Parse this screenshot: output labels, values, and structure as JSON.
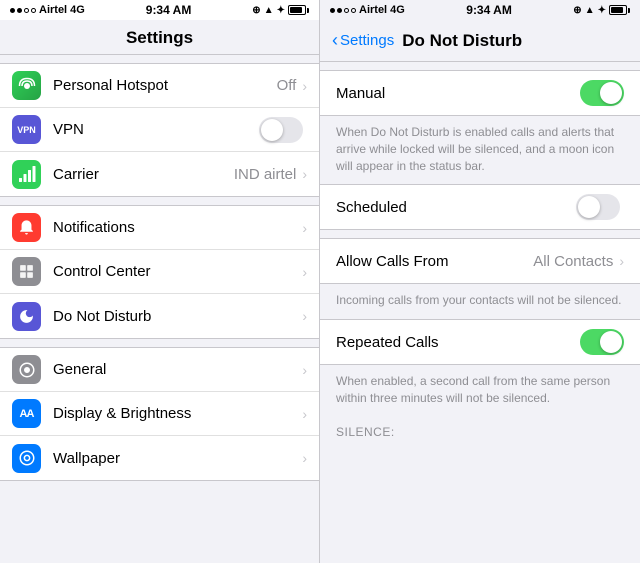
{
  "left": {
    "statusBar": {
      "carrier": "Airtel",
      "network": "4G",
      "time": "9:34 AM"
    },
    "header": "Settings",
    "groups": [
      {
        "items": [
          {
            "id": "hotspot",
            "label": "Personal Hotspot",
            "value": "Off",
            "iconClass": "icon-hotspot",
            "iconText": "⌘",
            "hasChevron": true,
            "hasToggle": false
          },
          {
            "id": "vpn",
            "label": "VPN",
            "value": "",
            "iconClass": "icon-vpn",
            "iconText": "VPN",
            "hasChevron": false,
            "hasToggle": true
          },
          {
            "id": "carrier",
            "label": "Carrier",
            "value": "IND airtel",
            "iconClass": "icon-carrier",
            "iconText": "📶",
            "hasChevron": true,
            "hasToggle": false
          }
        ]
      },
      {
        "items": [
          {
            "id": "notifications",
            "label": "Notifications",
            "value": "",
            "iconClass": "icon-notifications",
            "iconText": "🔔",
            "hasChevron": true,
            "hasToggle": false
          },
          {
            "id": "control",
            "label": "Control Center",
            "value": "",
            "iconClass": "icon-control",
            "iconText": "⚙",
            "hasChevron": true,
            "hasToggle": false
          },
          {
            "id": "dnd",
            "label": "Do Not Disturb",
            "value": "",
            "iconClass": "icon-dnd",
            "iconText": "🌙",
            "hasChevron": true,
            "hasToggle": false
          }
        ]
      },
      {
        "items": [
          {
            "id": "general",
            "label": "General",
            "value": "",
            "iconClass": "icon-general",
            "iconText": "⚙",
            "hasChevron": true,
            "hasToggle": false
          },
          {
            "id": "display",
            "label": "Display & Brightness",
            "value": "",
            "iconClass": "icon-display",
            "iconText": "AA",
            "hasChevron": true,
            "hasToggle": false
          },
          {
            "id": "wallpaper",
            "label": "Wallpaper",
            "value": "",
            "iconClass": "icon-wallpaper",
            "iconText": "❄",
            "hasChevron": true,
            "hasToggle": false
          }
        ]
      }
    ]
  },
  "right": {
    "statusBar": {
      "carrier": "Airtel",
      "network": "4G",
      "time": "9:34 AM"
    },
    "backLabel": "Settings",
    "title": "Do Not Disturb",
    "sections": [
      {
        "items": [
          {
            "id": "manual",
            "label": "Manual",
            "toggleOn": true
          }
        ],
        "description": "When Do Not Disturb is enabled calls and alerts that arrive while locked will be silenced, and a moon icon will appear in the status bar."
      },
      {
        "items": [
          {
            "id": "scheduled",
            "label": "Scheduled",
            "toggleOn": false
          }
        ]
      },
      {
        "items": [
          {
            "id": "allow-calls",
            "label": "Allow Calls From",
            "value": "All Contacts",
            "hasChevron": true
          }
        ],
        "description": "Incoming calls from your contacts will not be silenced."
      },
      {
        "items": [
          {
            "id": "repeated-calls",
            "label": "Repeated Calls",
            "toggleOn": true
          }
        ],
        "description": "When enabled, a second call from the same person within three minutes will not be silenced."
      }
    ],
    "silenceHeader": "SILENCE:"
  }
}
